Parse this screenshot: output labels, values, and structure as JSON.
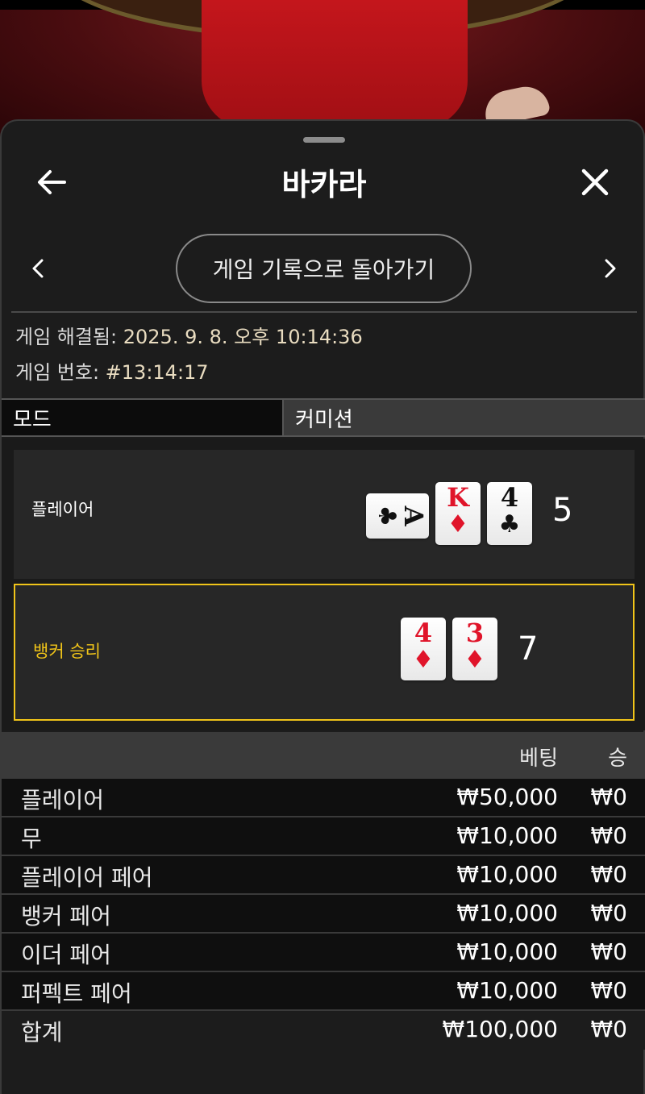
{
  "header": {
    "title": "바카라"
  },
  "nav": {
    "back_to_history": "게임 기록으로 돌아가기"
  },
  "meta": {
    "resolved_label": "게임 해결됨: ",
    "resolved_value": "2025. 9. 8. 오후 10:14:36",
    "game_no_label": "게임 번호: ",
    "game_no_value": "#13:14:17"
  },
  "mode": {
    "mode_label": "모드",
    "mode_value": "커미션"
  },
  "hands": {
    "player": {
      "label": "플레이어",
      "score": "5",
      "cards": [
        {
          "rank": "A",
          "suit": "♣",
          "color": "black",
          "sideways": true
        },
        {
          "rank": "K",
          "suit": "♦",
          "color": "red",
          "sideways": false
        },
        {
          "rank": "4",
          "suit": "♣",
          "color": "black",
          "sideways": false
        }
      ]
    },
    "banker": {
      "label": "뱅커 승리",
      "score": "7",
      "cards": [
        {
          "rank": "4",
          "suit": "♦",
          "color": "red",
          "sideways": false
        },
        {
          "rank": "3",
          "suit": "♦",
          "color": "red",
          "sideways": false
        }
      ]
    }
  },
  "bets": {
    "col_bet": "베팅",
    "col_win": "승",
    "rows": [
      {
        "name": "플레이어",
        "amount": "₩50,000",
        "win": "₩0"
      },
      {
        "name": "무",
        "amount": "₩10,000",
        "win": "₩0"
      },
      {
        "name": "플레이어 페어",
        "amount": "₩10,000",
        "win": "₩0"
      },
      {
        "name": "뱅커 페어",
        "amount": "₩10,000",
        "win": "₩0"
      },
      {
        "name": "이더 페어",
        "amount": "₩10,000",
        "win": "₩0"
      },
      {
        "name": "퍼펙트 페어",
        "amount": "₩10,000",
        "win": "₩0"
      }
    ],
    "total": {
      "name": "합계",
      "amount": "₩100,000",
      "win": "₩0"
    }
  },
  "colors": {
    "accent": "#f0c419",
    "card_red": "#e0142a"
  }
}
